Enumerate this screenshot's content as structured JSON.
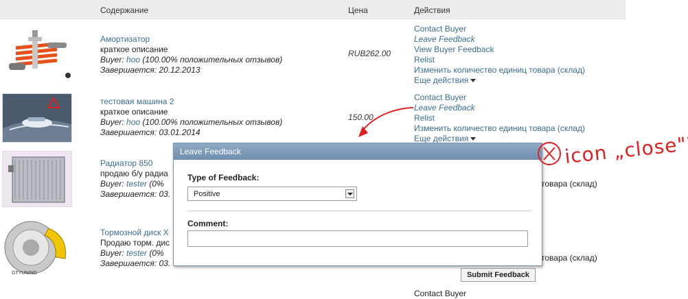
{
  "header": {
    "col_content": "Содержание",
    "col_price": "Цена",
    "col_actions": "Действия"
  },
  "rows": [
    {
      "title": "Амортизатор",
      "desc": "краткое описание",
      "buyer_prefix": "Buyer: ",
      "buyer_name": "hoo",
      "buyer_feedback": " (100.00% положительных отзывов)",
      "ends": "Завершается: 20.12.2013",
      "price": "RUB262.00",
      "actions": [
        "Contact Buyer",
        "Leave Feedback",
        "View Buyer Feedback",
        "Relist",
        "Изменить количество единиц товара (склад)",
        "Еще действия"
      ]
    },
    {
      "title": "тестовая машина 2",
      "desc": "краткое описание",
      "buyer_prefix": "Buyer: ",
      "buyer_name": "hoo",
      "buyer_feedback": " (100.00% положительных отзывов)",
      "ends": "Завершается: 03.01.2014",
      "price": "150.00",
      "actions": [
        "Contact Buyer",
        "Leave Feedback",
        "Relist",
        "Изменить количество единиц товара (склад)",
        "Еще действия"
      ]
    },
    {
      "title": "Радиатор 850",
      "desc": "продаю б/у радиа",
      "buyer_prefix": "Buyer: ",
      "buyer_name": "tester",
      "buyer_feedback": " (0%",
      "ends": "Завершается: 03.",
      "actions_visible": "товара (склад)"
    },
    {
      "title": "Тормозной диск Х",
      "desc": "Продаю торм. дис",
      "buyer_prefix": "Buyer: ",
      "buyer_name": "tester",
      "buyer_feedback": " (0%",
      "ends": "Завершается: 03.",
      "actions_visible": "товара (склад)",
      "logo_text": "GTYUNING"
    }
  ],
  "last_action": "Contact Buyer",
  "modal": {
    "title": "Leave Feedback",
    "type_label": "Type of Feedback:",
    "type_value": "Positive",
    "comment_label": "Comment:",
    "comment_value": "",
    "submit_label": "Submit Feedback"
  },
  "annotation": {
    "text": "icon „close\"?",
    "color": "#e02020"
  }
}
